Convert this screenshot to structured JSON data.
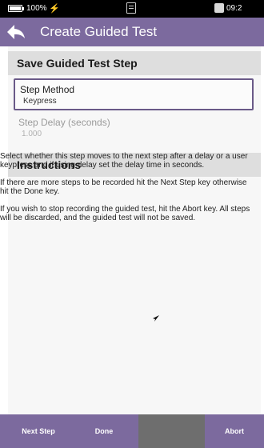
{
  "status_bar": {
    "battery": "100%",
    "time": "09:2"
  },
  "app_bar": {
    "title": "Create Guided Test"
  },
  "save_section": {
    "heading": "Save Guided Test Step",
    "step_method": {
      "label": "Step Method",
      "value": "Keypress"
    },
    "step_delay": {
      "label": "Step Delay (seconds)",
      "value": "1.000"
    }
  },
  "instructions": {
    "heading": "Instructions",
    "paragraphs": [
      "Select whether this step moves to the next step after a delay or a user keypress and if using delay set the delay time in seconds.",
      "If there are more steps to be recorded hit the Next Step key otherwise hit the Done key.",
      "If you wish to stop recording the guided test, hit the Abort key. All steps will be discarded, and the guided test will not be saved."
    ]
  },
  "softkeys": {
    "next_step": "Next Step",
    "done": "Done",
    "blank": "",
    "abort": "Abort"
  },
  "colors": {
    "accent": "#7c6a9e",
    "status_bar": "#000000",
    "section_header": "#dedede"
  }
}
